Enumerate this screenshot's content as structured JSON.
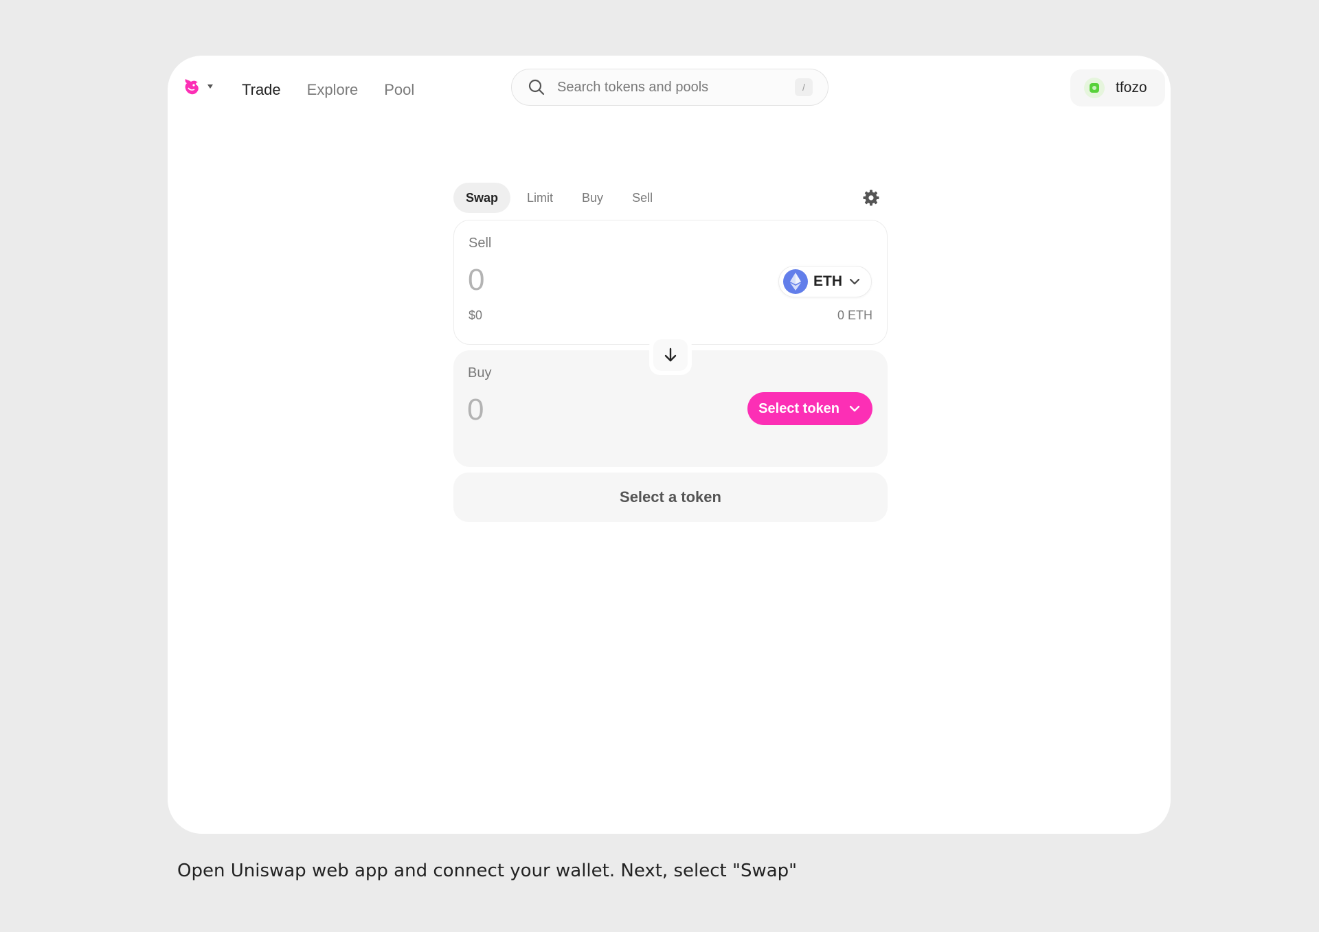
{
  "nav": {
    "logo_icon": "uniswap-unicorn-icon",
    "items": [
      {
        "label": "Trade",
        "active": true
      },
      {
        "label": "Explore",
        "active": false
      },
      {
        "label": "Pool",
        "active": false
      }
    ]
  },
  "search": {
    "placeholder": "Search tokens and pools",
    "shortcut": "/"
  },
  "account": {
    "name": "tfozo"
  },
  "swap": {
    "tabs": [
      {
        "label": "Swap",
        "active": true
      },
      {
        "label": "Limit",
        "active": false
      },
      {
        "label": "Buy",
        "active": false
      },
      {
        "label": "Sell",
        "active": false
      }
    ],
    "sell": {
      "label": "Sell",
      "amount": "0",
      "usd_value": "$0",
      "token": "ETH",
      "balance": "0 ETH"
    },
    "buy": {
      "label": "Buy",
      "amount": "0",
      "select_label": "Select token"
    },
    "cta_label": "Select a token"
  },
  "colors": {
    "accent": "#fc2fb5",
    "eth": "#627eea",
    "background": "#ebebeb"
  },
  "caption": "Open Uniswap web app and connect your wallet. Next, select \"Swap\""
}
